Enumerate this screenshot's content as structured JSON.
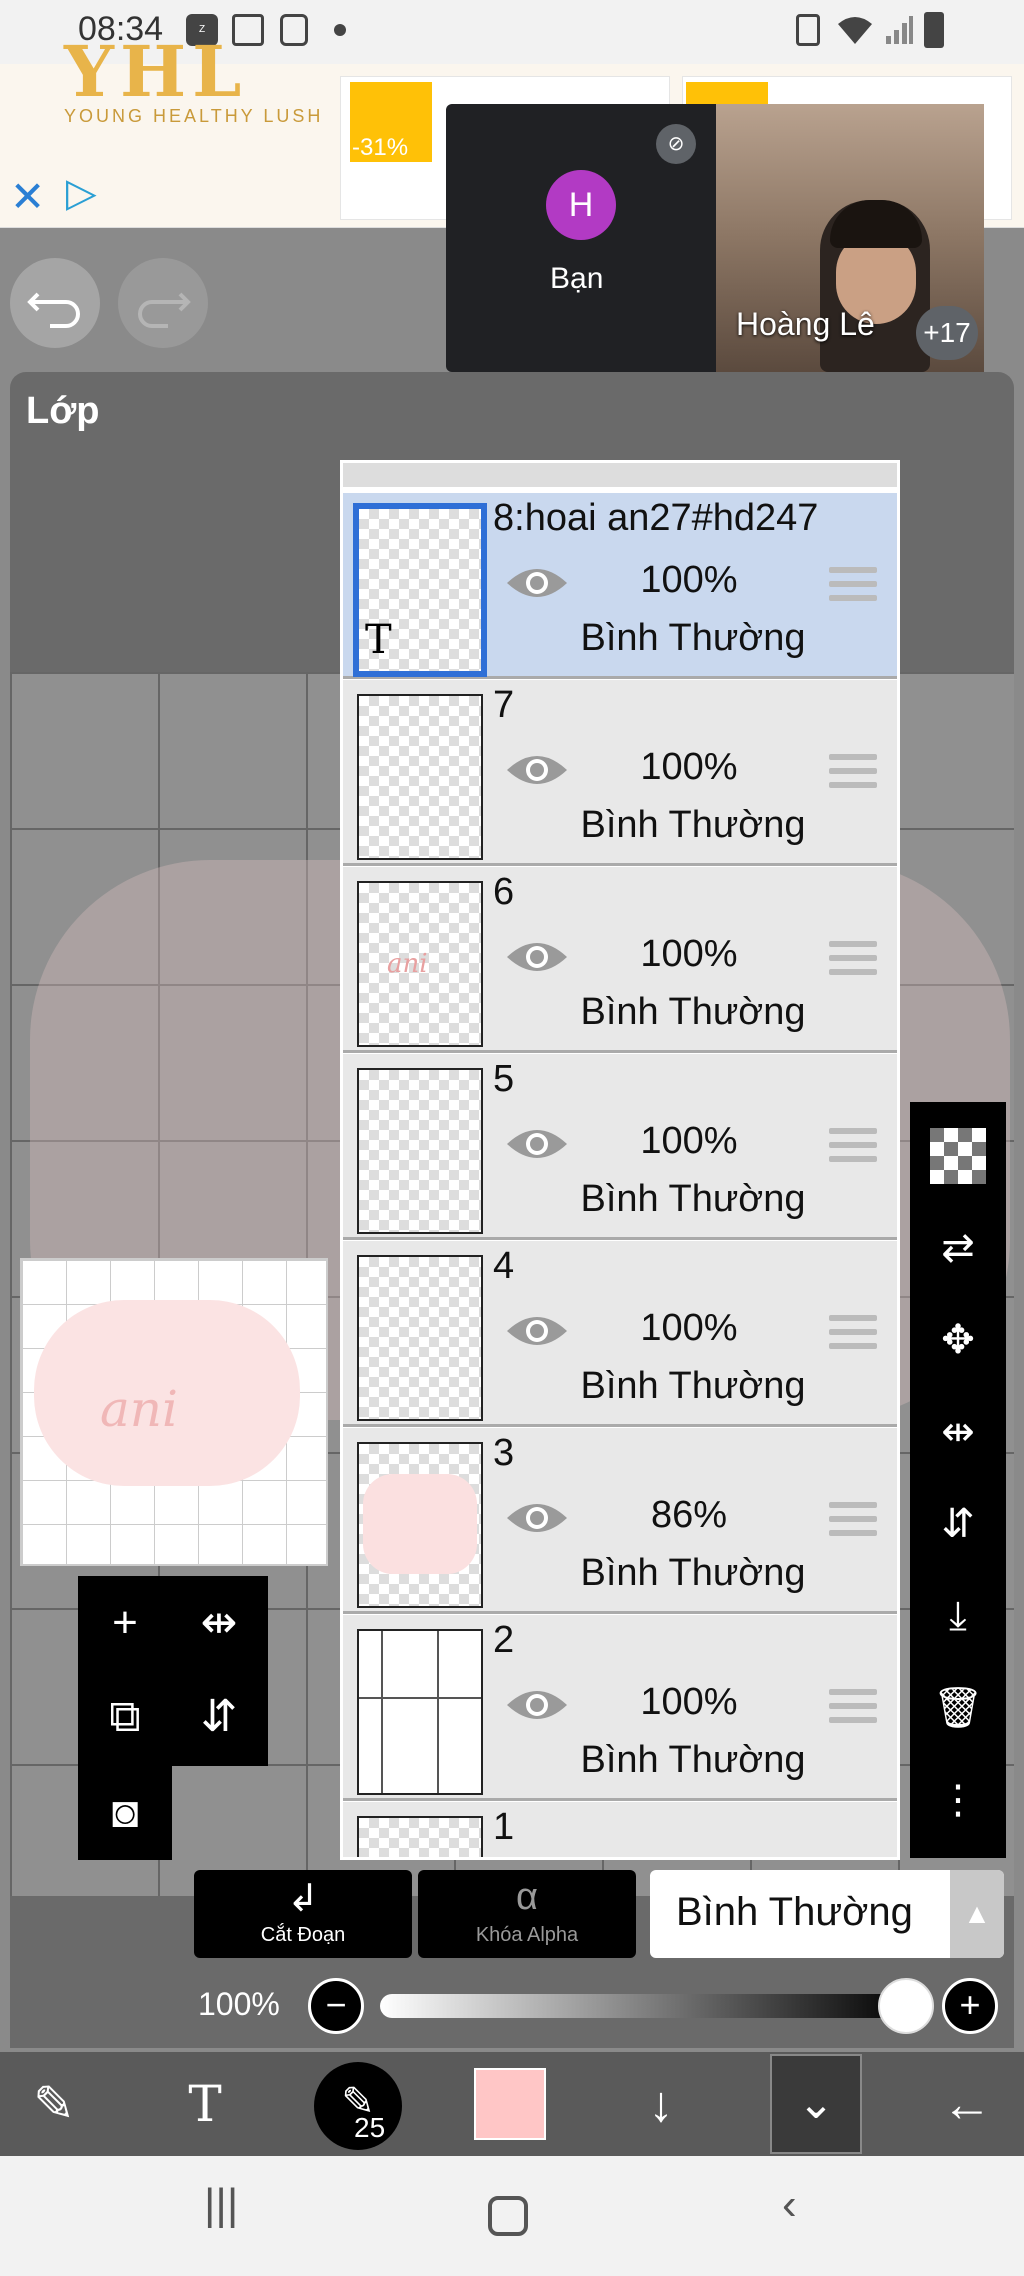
{
  "status_bar": {
    "time": "08:34",
    "left_icons": [
      "zalo-icon",
      "image-icon",
      "video-icon",
      "dot-icon"
    ],
    "right_icons": [
      "save-icon",
      "wifi-icon",
      "signal-icon",
      "battery-icon"
    ]
  },
  "ad": {
    "logo": "YHL",
    "tagline": "YOUNG HEALTHY LUSH",
    "discount": "-31%"
  },
  "meet": {
    "avatar_initial": "H",
    "you_label": "Bạn",
    "participant_name": "Hoàng Lê",
    "participant_count": "+17"
  },
  "panel": {
    "title": "Lớp"
  },
  "layers": [
    {
      "name": "8:hoai an27#hd247",
      "opacity": "100%",
      "mode": "Bình Thường",
      "selected": true
    },
    {
      "name": "7",
      "opacity": "100%",
      "mode": "Bình Thường",
      "selected": false
    },
    {
      "name": "6",
      "opacity": "100%",
      "mode": "Bình Thường",
      "selected": false
    },
    {
      "name": "5",
      "opacity": "100%",
      "mode": "Bình Thường",
      "selected": false
    },
    {
      "name": "4",
      "opacity": "100%",
      "mode": "Bình Thường",
      "selected": false
    },
    {
      "name": "3",
      "opacity": "86%",
      "mode": "Bình Thường",
      "selected": false
    },
    {
      "name": "2",
      "opacity": "100%",
      "mode": "Bình Thường",
      "selected": false
    },
    {
      "name": "1",
      "opacity": "",
      "mode": "",
      "selected": false
    }
  ],
  "preview": {
    "text": "ani",
    "thumb_text_t": "T",
    "thumb_text_layer6": "ani"
  },
  "controls": {
    "clip_label": "Cắt Đoạn",
    "alpha_label": "Khóa Alpha",
    "blend_mode": "Bình Thường",
    "opacity_label": "100%",
    "opacity_value": 1.0,
    "brush_size": "25",
    "brush_color": "#ffc6c6"
  }
}
